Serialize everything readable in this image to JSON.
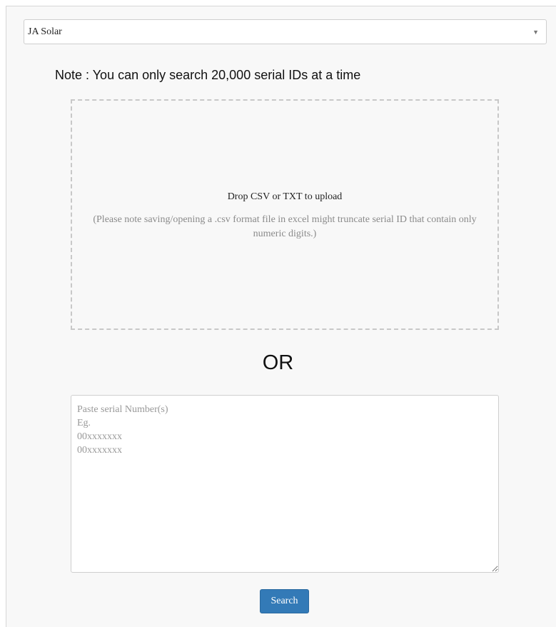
{
  "manufacturer_select": {
    "selected": "JA Solar",
    "arrow_icon": "▼"
  },
  "note": "Note : You can only search 20,000 serial IDs at a time",
  "dropzone": {
    "title": "Drop CSV or TXT to upload",
    "hint": "(Please note saving/opening a .csv format file in excel might truncate serial ID that contain only numeric digits.)"
  },
  "separator": "OR",
  "serial_input": {
    "placeholder": "Paste serial Number(s)\nEg.\n00xxxxxxx\n00xxxxxxx",
    "value": ""
  },
  "search_button": {
    "label": "Search",
    "color": "#337ab7"
  }
}
